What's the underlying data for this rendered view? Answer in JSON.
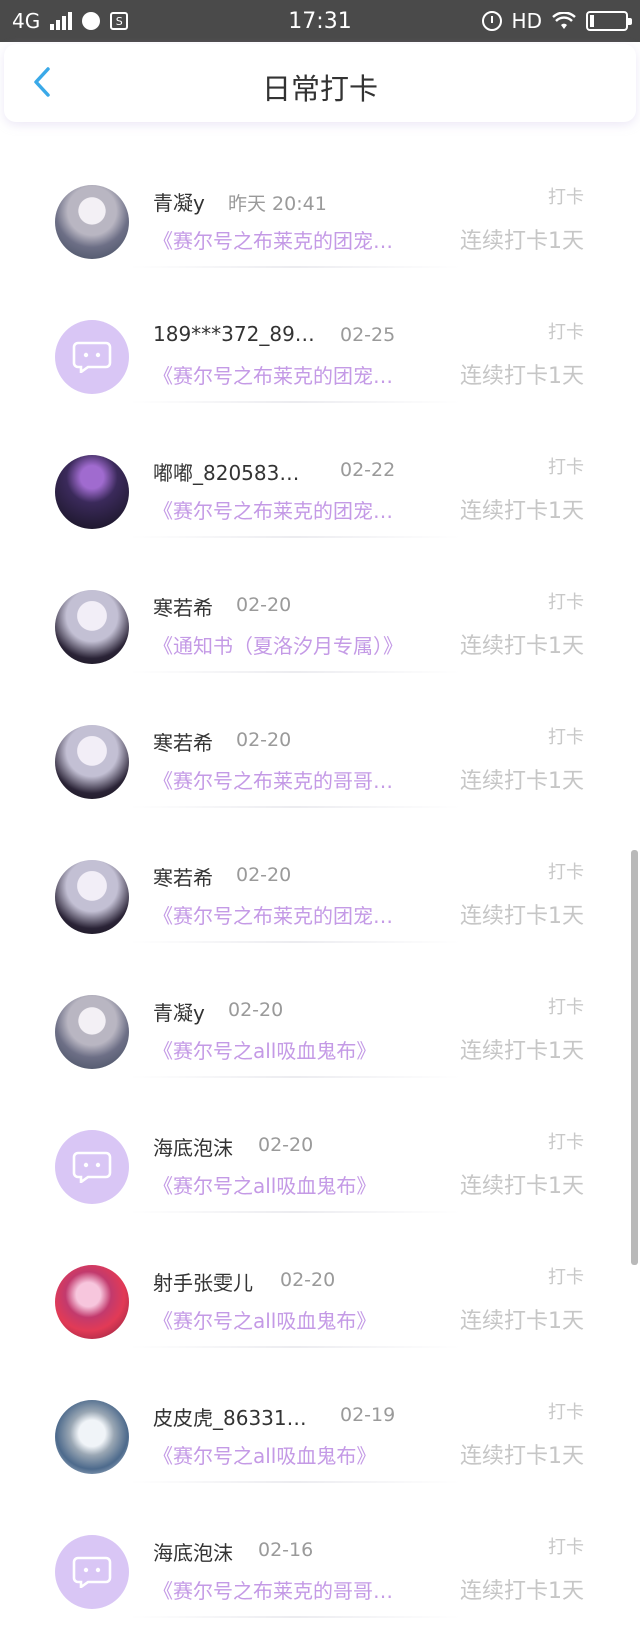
{
  "status_bar": {
    "network": "4G",
    "time": "17:31",
    "hd": "HD",
    "sim_icon_label": "S"
  },
  "header": {
    "title": "日常打卡",
    "back_icon": "chevron-left-icon"
  },
  "colors": {
    "accent": "#3aa9e8",
    "book_link": "#c49ae6",
    "default_avatar": "#d9c6f5"
  },
  "list": [
    {
      "name": "青凝y",
      "date": "昨天 20:41",
      "tag": "打卡",
      "book": "《赛尔号之布莱克的团宠…",
      "streak": "连续打卡1天",
      "avatar": "photo-a"
    },
    {
      "name": "189***372_89…",
      "date": "02-25",
      "tag": "打卡",
      "book": "《赛尔号之布莱克的团宠…",
      "streak": "连续打卡1天",
      "avatar": "default"
    },
    {
      "name": "嘟嘟_820583…",
      "date": "02-22",
      "tag": "打卡",
      "book": "《赛尔号之布莱克的团宠…",
      "streak": "连续打卡1天",
      "avatar": "photo-b"
    },
    {
      "name": "寒若希",
      "date": "02-20",
      "tag": "打卡",
      "book": "《通知书（夏洛汐月专属）》",
      "streak": "连续打卡1天",
      "avatar": "photo-c"
    },
    {
      "name": "寒若希",
      "date": "02-20",
      "tag": "打卡",
      "book": "《赛尔号之布莱克的哥哥…",
      "streak": "连续打卡1天",
      "avatar": "photo-c"
    },
    {
      "name": "寒若希",
      "date": "02-20",
      "tag": "打卡",
      "book": "《赛尔号之布莱克的团宠…",
      "streak": "连续打卡1天",
      "avatar": "photo-c"
    },
    {
      "name": "青凝y",
      "date": "02-20",
      "tag": "打卡",
      "book": "《赛尔号之all吸血鬼布》",
      "streak": "连续打卡1天",
      "avatar": "photo-a"
    },
    {
      "name": "海底泡沫",
      "date": "02-20",
      "tag": "打卡",
      "book": "《赛尔号之all吸血鬼布》",
      "streak": "连续打卡1天",
      "avatar": "default"
    },
    {
      "name": "射手张雯儿",
      "date": "02-20",
      "tag": "打卡",
      "book": "《赛尔号之all吸血鬼布》",
      "streak": "连续打卡1天",
      "avatar": "photo-d"
    },
    {
      "name": "皮皮虎_86331…",
      "date": "02-19",
      "tag": "打卡",
      "book": "《赛尔号之all吸血鬼布》",
      "streak": "连续打卡1天",
      "avatar": "photo-e"
    },
    {
      "name": "海底泡沫",
      "date": "02-16",
      "tag": "打卡",
      "book": "《赛尔号之布莱克的哥哥…",
      "streak": "连续打卡1天",
      "avatar": "default"
    }
  ]
}
